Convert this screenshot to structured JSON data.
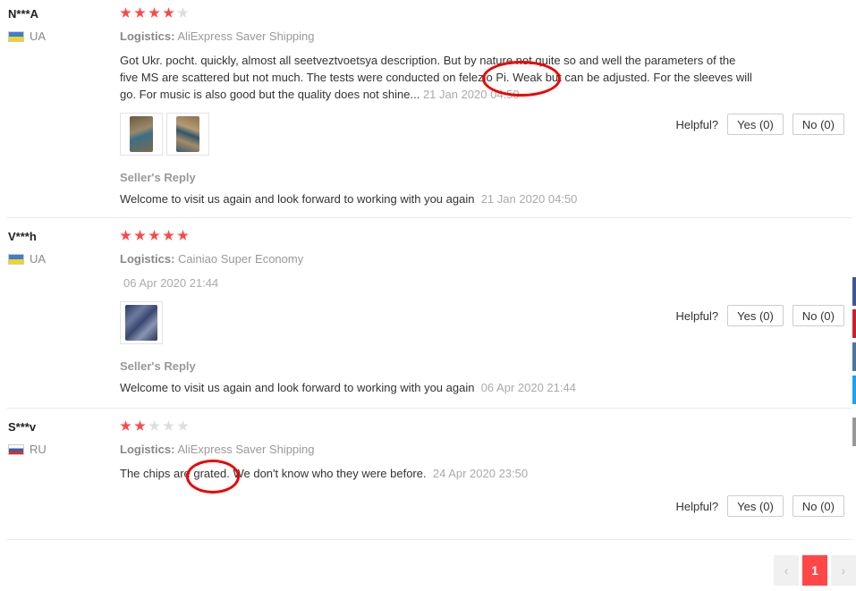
{
  "reviews": [
    {
      "user": "N***A",
      "country": "UA",
      "rating": 4,
      "logistics_label": "Logistics:",
      "logistics": "AliExpress Saver Shipping",
      "text": "Got Ukr. pocht. quickly, almost all seetveztvoetsya description. But by nature not quite so and well the parameters of the five MS are scattered but not much. The tests were conducted on felezio Pi. Weak but can be adjusted. For the sleeves will go. For music is also good but the quality does not shine...",
      "date": "21 Jan 2020 04:50",
      "photos": [
        "photo-1",
        "photo-2"
      ],
      "seller_reply_label": "Seller's Reply",
      "seller_reply": "Welcome to visit us again and look forward to working with you again",
      "seller_reply_date": "21 Jan 2020 04:50",
      "helpful_label": "Helpful?",
      "yes_label": "Yes (0)",
      "no_label": "No (0)"
    },
    {
      "user": "V***h",
      "country": "UA",
      "rating": 5,
      "logistics_label": "Logistics:",
      "logistics": "Cainiao Super Economy",
      "text": "",
      "date": "06 Apr 2020 21:44",
      "photos": [
        "photo-1"
      ],
      "seller_reply_label": "Seller's Reply",
      "seller_reply": "Welcome to visit us again and look forward to working with you again",
      "seller_reply_date": "06 Apr 2020 21:44",
      "helpful_label": "Helpful?",
      "yes_label": "Yes (0)",
      "no_label": "No (0)"
    },
    {
      "user": "S***v",
      "country": "RU",
      "rating": 2,
      "logistics_label": "Logistics:",
      "logistics": "AliExpress Saver Shipping",
      "text": "The chips are grated. We don't know who they were before.",
      "date": "24 Apr 2020 23:50",
      "helpful_label": "Helpful?",
      "yes_label": "Yes (0)",
      "no_label": "No (0)"
    }
  ],
  "pagination": {
    "prev": "‹",
    "current": "1",
    "next": "›"
  },
  "colors": {
    "star_on": "#ff4747",
    "star_off": "#dddddd",
    "accent": "#ff4747",
    "annotation": "#e00000"
  }
}
